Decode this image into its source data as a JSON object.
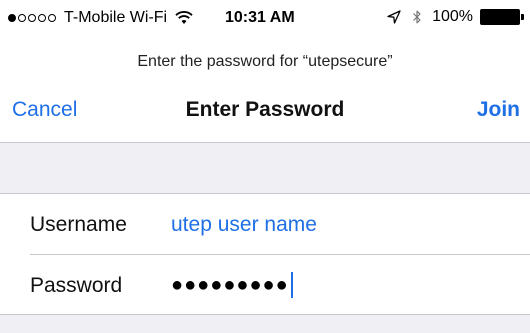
{
  "status_bar": {
    "carrier": "T-Mobile Wi-Fi",
    "signal_dots_filled": 1,
    "signal_dots_total": 5,
    "wifi_icon": "wifi-icon",
    "time": "10:31 AM",
    "location_icon": "location-arrow-icon",
    "bluetooth_icon": "bluetooth-icon",
    "battery": "100%",
    "battery_level": 1.0
  },
  "prompt": {
    "text": "Enter the password for “utepsecure”"
  },
  "nav": {
    "cancel_label": "Cancel",
    "title": "Enter Password",
    "join_label": "Join"
  },
  "form": {
    "username_label": "Username",
    "username_value": "utep user name",
    "password_label": "Password",
    "password_value": "●●●●●●●●●"
  },
  "colors": {
    "accent": "#1f6fe6",
    "background": "#efeff4",
    "separator": "#c8c7cc"
  }
}
